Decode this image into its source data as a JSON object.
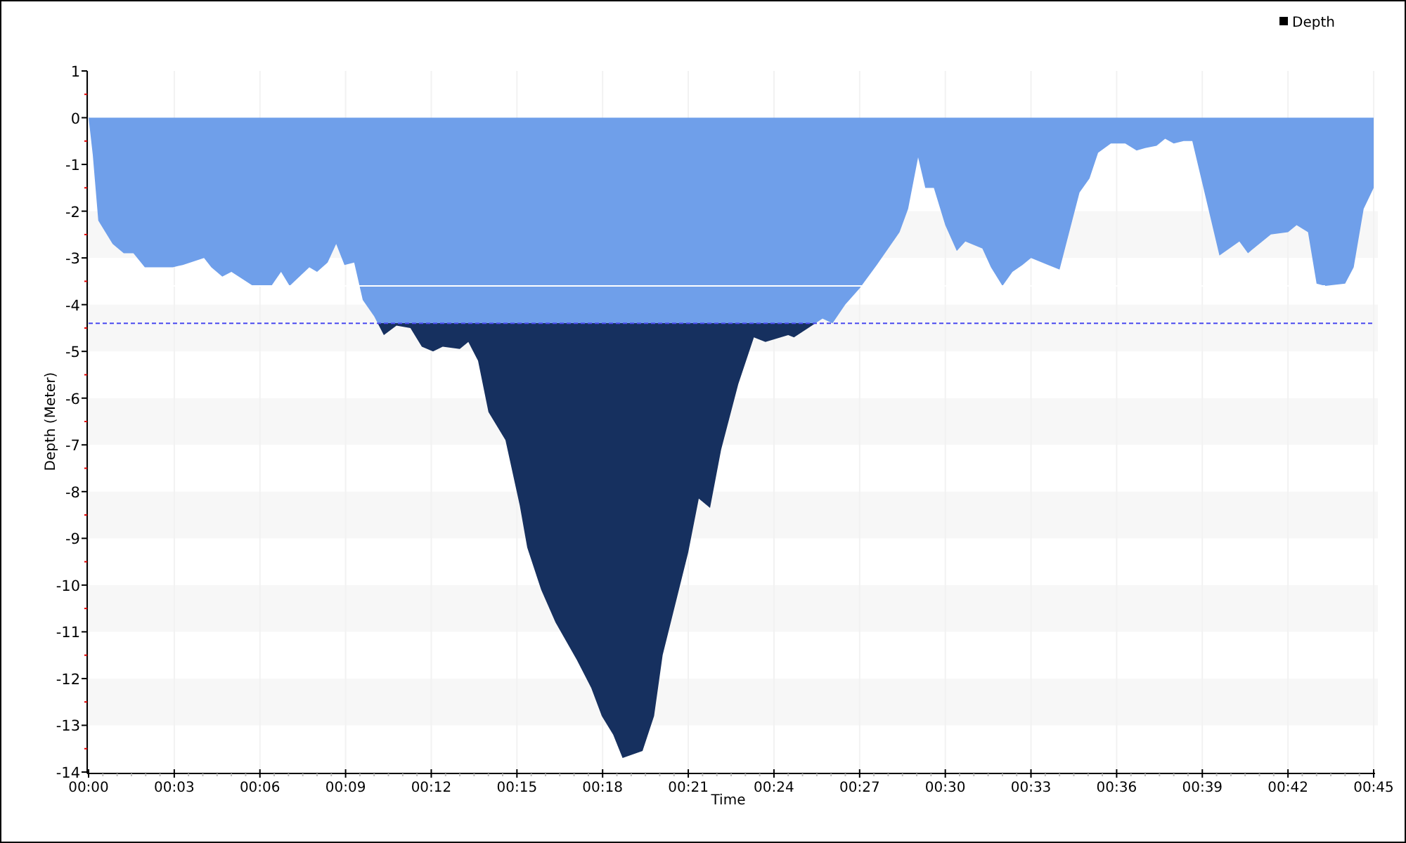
{
  "chart_data": {
    "type": "area",
    "xlabel": "Time",
    "ylabel": "Depth (Meter)",
    "x": [
      0,
      0.15,
      0.34,
      0.84,
      1.23,
      1.57,
      1.97,
      2.95,
      3.3,
      4.04,
      4.3,
      4.68,
      5.0,
      5.76,
      6.4,
      6.74,
      7.04,
      7.73,
      8.0,
      8.37,
      8.67,
      8.96,
      9.3,
      9.6,
      10.0,
      10.34,
      10.78,
      11.27,
      11.67,
      12.06,
      12.4,
      13.0,
      13.3,
      13.64,
      14.0,
      14.6,
      15.1,
      15.36,
      15.85,
      16.35,
      17.1,
      17.6,
      17.97,
      18.37,
      18.7,
      19.4,
      19.8,
      20.1,
      21.0,
      21.37,
      21.76,
      22.15,
      22.75,
      23.3,
      23.7,
      24.5,
      24.7,
      25.2,
      25.7,
      26.05,
      26.5,
      27.0,
      27.6,
      28.4,
      28.7,
      29.05,
      29.3,
      29.6,
      30.0,
      30.4,
      30.7,
      31.3,
      31.6,
      32.0,
      32.35,
      32.7,
      33.0,
      33.6,
      34.0,
      34.7,
      35.05,
      35.35,
      35.8,
      36.3,
      36.7,
      37.0,
      37.4,
      37.7,
      38.0,
      38.35,
      38.65,
      39.0,
      39.6,
      40.3,
      40.6,
      41.4,
      42.0,
      42.3,
      42.7,
      43.0,
      43.3,
      44.0,
      44.3,
      44.65,
      45
    ],
    "series": [
      {
        "name": "Depth",
        "color": "#6f9fea",
        "values": [
          0,
          -0.8,
          -2.2,
          -2.7,
          -2.9,
          -2.9,
          -3.2,
          -3.2,
          -3.15,
          -3.0,
          -3.2,
          -3.4,
          -3.3,
          -3.6,
          -3.6,
          -3.3,
          -3.6,
          -3.2,
          -3.3,
          -3.1,
          -2.7,
          -3.15,
          -3.1,
          -3.9,
          -4.25,
          -4.65,
          -4.45,
          -4.5,
          -4.9,
          -5.0,
          -4.9,
          -4.95,
          -4.8,
          -5.2,
          -6.3,
          -6.9,
          -8.3,
          -9.2,
          -10.1,
          -10.8,
          -11.6,
          -12.2,
          -12.8,
          -13.2,
          -13.7,
          -13.55,
          -12.8,
          -11.5,
          -9.3,
          -8.15,
          -8.35,
          -7.1,
          -5.7,
          -4.7,
          -4.8,
          -4.65,
          -4.7,
          -4.5,
          -4.3,
          -4.4,
          -4.0,
          -3.65,
          -3.15,
          -2.45,
          -1.95,
          -0.85,
          -1.5,
          -1.5,
          -2.3,
          -2.85,
          -2.65,
          -2.8,
          -3.2,
          -3.6,
          -3.3,
          -3.15,
          -3.0,
          -3.15,
          -3.25,
          -1.6,
          -1.3,
          -0.75,
          -0.55,
          -0.55,
          -0.7,
          -0.65,
          -0.6,
          -0.45,
          -0.55,
          -0.5,
          -0.5,
          -1.4,
          -2.95,
          -2.65,
          -2.9,
          -2.5,
          -2.45,
          -2.3,
          -2.45,
          -3.55,
          -3.6,
          -3.55,
          -3.2,
          -1.95,
          -1.5
        ]
      }
    ],
    "xlim": [
      0,
      45
    ],
    "ylim": [
      -14,
      1
    ],
    "xticks": [
      {
        "value": 0,
        "label": "00:00"
      },
      {
        "value": 3,
        "label": "00:03"
      },
      {
        "value": 6,
        "label": "00:06"
      },
      {
        "value": 9,
        "label": "00:09"
      },
      {
        "value": 12,
        "label": "00:12"
      },
      {
        "value": 15,
        "label": "00:15"
      },
      {
        "value": 18,
        "label": "00:18"
      },
      {
        "value": 21,
        "label": "00:21"
      },
      {
        "value": 24,
        "label": "00:24"
      },
      {
        "value": 27,
        "label": "00:27"
      },
      {
        "value": 30,
        "label": "00:30"
      },
      {
        "value": 33,
        "label": "00:33"
      },
      {
        "value": 36,
        "label": "00:36"
      },
      {
        "value": 39,
        "label": "00:39"
      },
      {
        "value": 42,
        "label": "00:42"
      },
      {
        "value": 45,
        "label": "00:45"
      }
    ],
    "yticks": [
      1,
      0,
      -1,
      -2,
      -3,
      -4,
      -5,
      -6,
      -7,
      -8,
      -9,
      -10,
      -11,
      -12,
      -13,
      -14
    ],
    "grid": true,
    "ref_lines": [
      {
        "axis": "y",
        "value": -4.4,
        "color": "#4a4af0"
      },
      {
        "axis": "y",
        "value": -3.6,
        "color": "#ffffff"
      }
    ]
  }
}
